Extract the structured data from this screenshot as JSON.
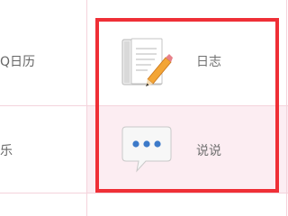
{
  "left_column": {
    "row1_label": "Q日历",
    "row2_label": "乐"
  },
  "apps": [
    {
      "label": "日志",
      "icon": "notebook-pencil-icon"
    },
    {
      "label": "说说",
      "icon": "speech-bubble-icon"
    }
  ],
  "colors": {
    "highlight": "#ef2f36",
    "hover_row": "#fcedf2",
    "grid_line": "#f4d3dc"
  }
}
